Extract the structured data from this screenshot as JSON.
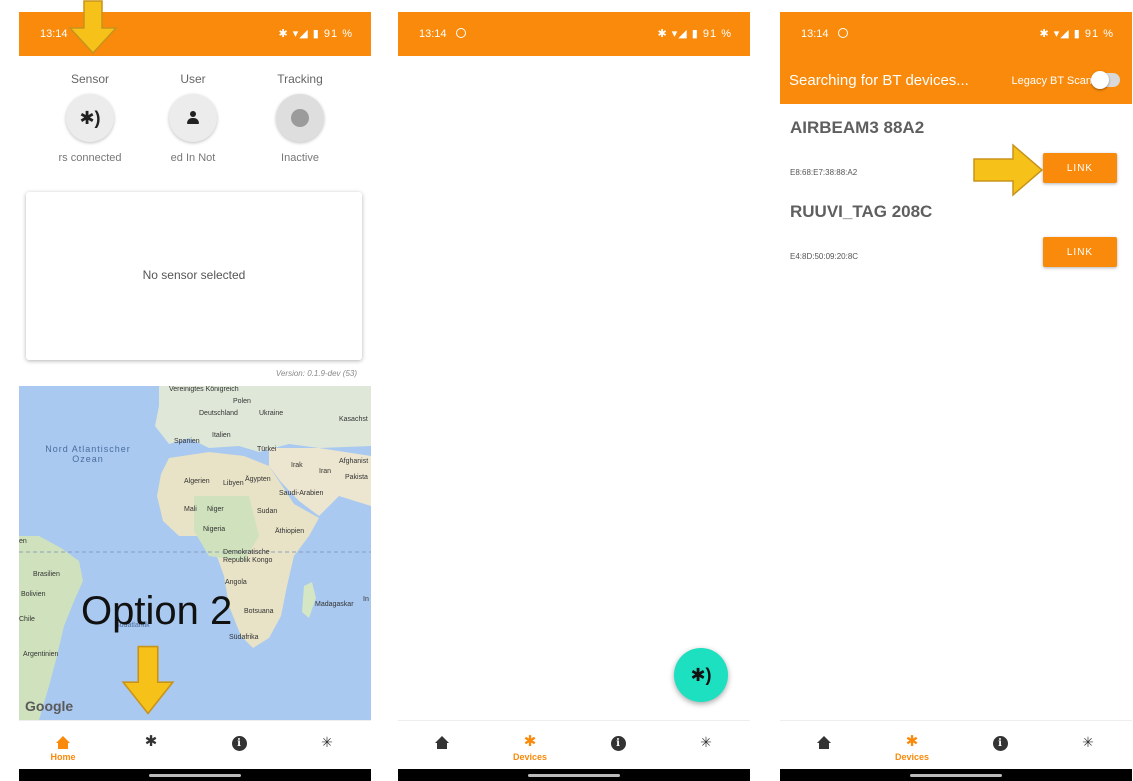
{
  "status_bar": {
    "time": "13:14",
    "icons": "✱ ▾◢ ▮ 91 %"
  },
  "home_screen": {
    "sensor": {
      "title": "Sensor",
      "status": "rs connected"
    },
    "user": {
      "title": "User",
      "status": "ed In    Not"
    },
    "tracking": {
      "title": "Tracking",
      "status": "Inactive"
    },
    "sensor_card_text": "No sensor selected",
    "version": "Version: 0.1.9-dev (53)",
    "map": {
      "labels": [
        "Vereinigtes Königreich",
        "Polen",
        "Deutschland",
        "Ukraine",
        "Kasachst",
        "Spanien",
        "Italien",
        "Türkei",
        "Irak",
        "Iran",
        "Afghanist",
        "Pakista",
        "Algerien",
        "Libyen",
        "Ägypten",
        "Saudi-Arabien",
        "Mali",
        "Niger",
        "Sudan",
        "Nigeria",
        "Äthiopien",
        "Demokratische Republik Kongo",
        "Angola",
        "Brasilien",
        "Bolivien",
        "Chile",
        "Madagaskar",
        "Botsuana",
        "Südafrika",
        "Argentinien",
        "Südatlantik",
        "en",
        "In"
      ],
      "ocean_label": "Nord Atlantischer Ozean",
      "google": "Google"
    },
    "annotation": "Option 2"
  },
  "bottom_nav": {
    "home": "Home",
    "devices": "Devices"
  },
  "device_screen": {
    "title": "Searching for BT devices...",
    "legacy_label": "Legacy BT Scan",
    "legacy_enabled": false,
    "devices": [
      {
        "name": "AIRBEAM3 88A2",
        "mac": "E8:68:E7:38:88:A2",
        "action": "LINK"
      },
      {
        "name": "RUUVI_TAG 208C",
        "mac": "E4:8D:50:09:20:8C",
        "action": "LINK"
      }
    ]
  },
  "colors": {
    "accent": "#f98a0b",
    "fab": "#1de0c0",
    "arrow": "#f6c21a"
  },
  "icons": [
    "bluetooth-icon",
    "person-icon",
    "tracking-icon",
    "home-icon",
    "info-icon",
    "bug-icon",
    "toggle-icon"
  ]
}
